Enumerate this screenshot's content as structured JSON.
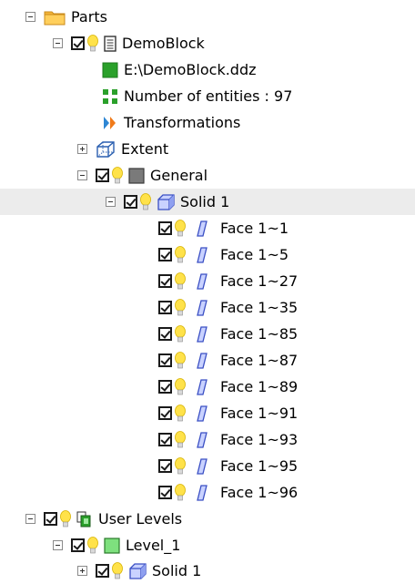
{
  "tree": {
    "parts": {
      "label": "Parts"
    },
    "demoblock": {
      "label": "DemoBlock"
    },
    "file": {
      "label": "E:\\DemoBlock.ddz"
    },
    "entities": {
      "label": "Number of entities : 97"
    },
    "transformations": {
      "label": "Transformations"
    },
    "extent": {
      "label": "Extent"
    },
    "general": {
      "label": "General"
    },
    "solid1": {
      "label": "Solid 1"
    },
    "faces": [
      "Face 1~1",
      "Face 1~5",
      "Face 1~27",
      "Face 1~35",
      "Face 1~85",
      "Face 1~87",
      "Face 1~89",
      "Face 1~91",
      "Face 1~93",
      "Face 1~95",
      "Face 1~96"
    ],
    "user_levels": {
      "label": "User Levels"
    },
    "level1": {
      "label": "Level_1"
    },
    "level1_solid": {
      "label": "Solid 1"
    }
  },
  "colors": {
    "selection": "#ececec",
    "folder": "#f5b53a",
    "bulb": "#ffe24a",
    "solid": "#3a4fc4",
    "file_green": "#2aa02a",
    "general_gray": "#7a7a7a"
  }
}
